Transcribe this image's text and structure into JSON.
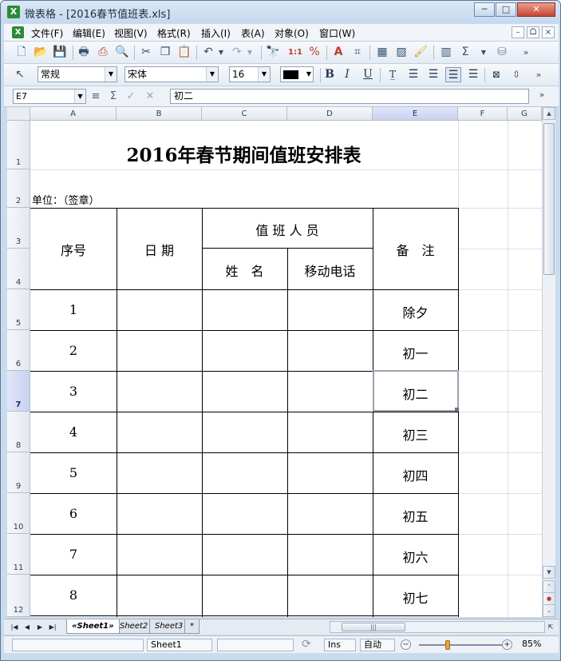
{
  "window": {
    "app_name": "微表格 - [2016春节值班表.xls]",
    "minimize": "─",
    "maximize": "□",
    "close": "✕",
    "app_icon": "X"
  },
  "menubar": {
    "icon": "X",
    "items": [
      "文件(F)",
      "编辑(E)",
      "视图(V)",
      "格式(R)",
      "插入(I)",
      "表(A)",
      "对象(O)",
      "窗口(W)"
    ],
    "mdi": [
      "–",
      "ᗝ",
      "×"
    ]
  },
  "format_toolbar": {
    "style": "常规",
    "font": "宋体",
    "size": "16",
    "bold": "B",
    "italic": "I",
    "underline": "U"
  },
  "formula_bar": {
    "cell_ref": "E7",
    "content": "初二"
  },
  "columns": [
    "A",
    "B",
    "C",
    "D",
    "E",
    "F",
    "G"
  ],
  "rows": [
    "1",
    "2",
    "3",
    "4",
    "5",
    "6",
    "7",
    "8",
    "9",
    "10",
    "11",
    "12"
  ],
  "table": {
    "title": "2016年春节期间值班安排表",
    "unit_label": "单位：（签章）",
    "headers": {
      "seq": "序号",
      "date": "日 期",
      "duty_group": "值 班 人 员",
      "name": "姓　名",
      "phone": "移动电话",
      "remarks": "备　注"
    },
    "data_rows": [
      {
        "seq": "1",
        "remark": "除夕"
      },
      {
        "seq": "2",
        "remark": "初一"
      },
      {
        "seq": "3",
        "remark": "初二"
      },
      {
        "seq": "4",
        "remark": "初三"
      },
      {
        "seq": "5",
        "remark": "初四"
      },
      {
        "seq": "6",
        "remark": "初五"
      },
      {
        "seq": "7",
        "remark": "初六"
      },
      {
        "seq": "8",
        "remark": "初七"
      }
    ]
  },
  "tabs": [
    "«Sheet1»",
    "Sheet2",
    "Sheet3",
    "*"
  ],
  "status": {
    "sheet": "Sheet1",
    "mode": "Ins",
    "calc": "自动",
    "zoom": "85%"
  }
}
